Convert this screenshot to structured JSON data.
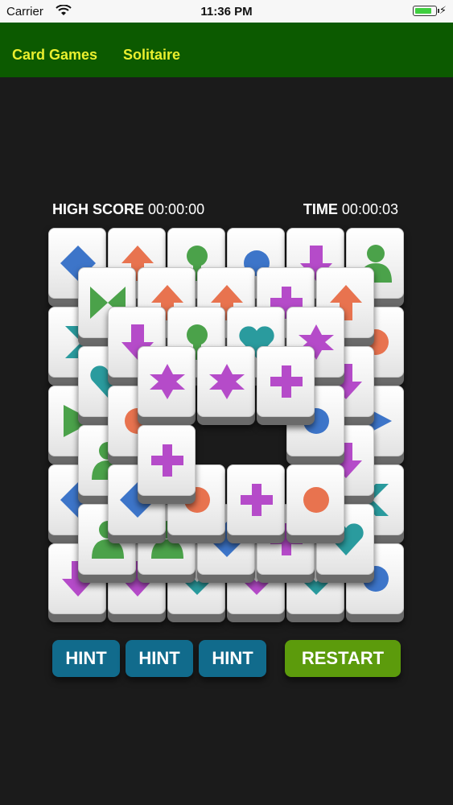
{
  "status_bar": {
    "carrier": "Carrier",
    "time": "11:36 PM",
    "wifi_icon": "wifi-icon",
    "battery_icon": "battery-icon"
  },
  "nav": {
    "card_games": "Card Games",
    "solitaire": "Solitaire"
  },
  "score": {
    "high_score_label": "HIGH SCORE",
    "high_score_value": "00:00:00",
    "time_label": "TIME",
    "time_value": "00:00:03"
  },
  "buttons": {
    "hint_1": "HINT",
    "hint_2": "HINT",
    "hint_3": "HINT",
    "restart": "RESTART"
  },
  "colors": {
    "blue": "#3d75c9",
    "orange": "#e8734f",
    "green": "#4ba24a",
    "purple": "#b54bc9",
    "teal": "#2a9b9e"
  },
  "tiles": [
    {
      "layer": 0,
      "row": 0,
      "col": 0,
      "symbol": "diamond",
      "color": "blue"
    },
    {
      "layer": 0,
      "row": 0,
      "col": 1,
      "symbol": "arrow-up",
      "color": "orange"
    },
    {
      "layer": 0,
      "row": 0,
      "col": 2,
      "symbol": "pin",
      "color": "green"
    },
    {
      "layer": 0,
      "row": 0,
      "col": 3,
      "symbol": "circle",
      "color": "blue"
    },
    {
      "layer": 0,
      "row": 0,
      "col": 4,
      "symbol": "arrow-down",
      "color": "purple"
    },
    {
      "layer": 0,
      "row": 0,
      "col": 5,
      "symbol": "person",
      "color": "green"
    },
    {
      "layer": 0,
      "row": 1,
      "col": 0,
      "symbol": "chevron-right",
      "color": "teal"
    },
    {
      "layer": 0,
      "row": 1,
      "col": 5,
      "symbol": "circle",
      "color": "orange"
    },
    {
      "layer": 0,
      "row": 2,
      "col": 0,
      "symbol": "triangle-right",
      "color": "green"
    },
    {
      "layer": 0,
      "row": 2,
      "col": 5,
      "symbol": "triangle-right",
      "color": "blue"
    },
    {
      "layer": 0,
      "row": 3,
      "col": 0,
      "symbol": "diamond",
      "color": "blue"
    },
    {
      "layer": 0,
      "row": 3,
      "col": 5,
      "symbol": "chevron-left",
      "color": "teal"
    },
    {
      "layer": 0,
      "row": 4,
      "col": 0,
      "symbol": "arrow-down",
      "color": "purple"
    },
    {
      "layer": 0,
      "row": 4,
      "col": 1,
      "symbol": "arrow-down",
      "color": "purple"
    },
    {
      "layer": 0,
      "row": 4,
      "col": 2,
      "symbol": "chevron-down",
      "color": "teal"
    },
    {
      "layer": 0,
      "row": 4,
      "col": 3,
      "symbol": "chevron-down",
      "color": "purple"
    },
    {
      "layer": 0,
      "row": 4,
      "col": 4,
      "symbol": "chevron-down",
      "color": "teal"
    },
    {
      "layer": 0,
      "row": 4,
      "col": 5,
      "symbol": "circle",
      "color": "blue"
    },
    {
      "layer": 1,
      "row": 0,
      "col": 0,
      "symbol": "bowtie",
      "color": "green"
    },
    {
      "layer": 1,
      "row": 0,
      "col": 1,
      "symbol": "arrow-up",
      "color": "orange"
    },
    {
      "layer": 1,
      "row": 0,
      "col": 2,
      "symbol": "arrow-up",
      "color": "orange"
    },
    {
      "layer": 1,
      "row": 0,
      "col": 3,
      "symbol": "plus",
      "color": "purple"
    },
    {
      "layer": 1,
      "row": 0,
      "col": 4,
      "symbol": "arrow-up",
      "color": "orange"
    },
    {
      "layer": 1,
      "row": 1,
      "col": 0,
      "symbol": "heart",
      "color": "teal"
    },
    {
      "layer": 1,
      "row": 1,
      "col": 4,
      "symbol": "arrow-down",
      "color": "purple"
    },
    {
      "layer": 1,
      "row": 2,
      "col": 0,
      "symbol": "person",
      "color": "green"
    },
    {
      "layer": 1,
      "row": 2,
      "col": 4,
      "symbol": "arrow-down",
      "color": "purple"
    },
    {
      "layer": 1,
      "row": 3,
      "col": 0,
      "symbol": "person",
      "color": "green"
    },
    {
      "layer": 1,
      "row": 3,
      "col": 1,
      "symbol": "person",
      "color": "green"
    },
    {
      "layer": 1,
      "row": 3,
      "col": 2,
      "symbol": "diamond",
      "color": "blue"
    },
    {
      "layer": 1,
      "row": 3,
      "col": 3,
      "symbol": "plus",
      "color": "purple"
    },
    {
      "layer": 1,
      "row": 3,
      "col": 4,
      "symbol": "heart",
      "color": "teal"
    },
    {
      "layer": 2,
      "row": 0,
      "col": 0,
      "symbol": "arrow-down",
      "color": "purple"
    },
    {
      "layer": 2,
      "row": 0,
      "col": 1,
      "symbol": "pin",
      "color": "green"
    },
    {
      "layer": 2,
      "row": 0,
      "col": 2,
      "symbol": "heart",
      "color": "teal"
    },
    {
      "layer": 2,
      "row": 0,
      "col": 3,
      "symbol": "star",
      "color": "purple"
    },
    {
      "layer": 2,
      "row": 1,
      "col": 0,
      "symbol": "circle",
      "color": "orange"
    },
    {
      "layer": 2,
      "row": 1,
      "col": 3,
      "symbol": "circle",
      "color": "blue"
    },
    {
      "layer": 2,
      "row": 2,
      "col": 0,
      "symbol": "diamond",
      "color": "blue"
    },
    {
      "layer": 2,
      "row": 2,
      "col": 1,
      "symbol": "circle",
      "color": "orange"
    },
    {
      "layer": 2,
      "row": 2,
      "col": 2,
      "symbol": "plus",
      "color": "purple"
    },
    {
      "layer": 2,
      "row": 2,
      "col": 3,
      "symbol": "circle",
      "color": "orange"
    },
    {
      "layer": 3,
      "row": 0,
      "col": 0,
      "symbol": "star",
      "color": "purple"
    },
    {
      "layer": 3,
      "row": 0,
      "col": 1,
      "symbol": "star",
      "color": "purple"
    },
    {
      "layer": 3,
      "row": 0,
      "col": 2,
      "symbol": "plus",
      "color": "purple"
    },
    {
      "layer": 3,
      "row": 1,
      "col": 0,
      "symbol": "plus",
      "color": "purple"
    }
  ]
}
